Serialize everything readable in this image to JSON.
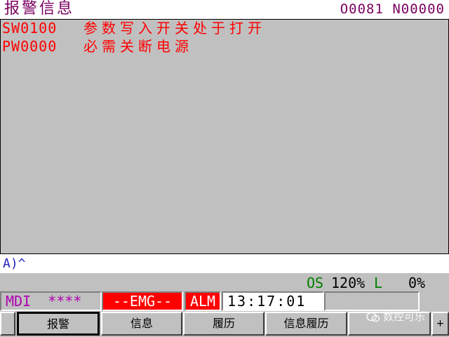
{
  "header": {
    "title": "报警信息",
    "program": "O0081 N00000"
  },
  "alarms": [
    {
      "code": "SW0100",
      "message": "参数写入开关处于打开"
    },
    {
      "code": "PW0000",
      "message": "必需关断电源"
    }
  ],
  "input": {
    "prompt": "A)^"
  },
  "override": {
    "label": "OS",
    "value": "120%",
    "l_label": "L",
    "l_value": "0%"
  },
  "status": {
    "mode": "MDI",
    "stars": "****",
    "emg": "--EMG--",
    "alm": "ALM",
    "clock": "13:17:01"
  },
  "softkeys": {
    "left": "",
    "k1": "报警",
    "k2": "信息",
    "k3": "履历",
    "k4": "信息履历",
    "k5": "",
    "right": "+"
  },
  "watermark": "数控可乐"
}
